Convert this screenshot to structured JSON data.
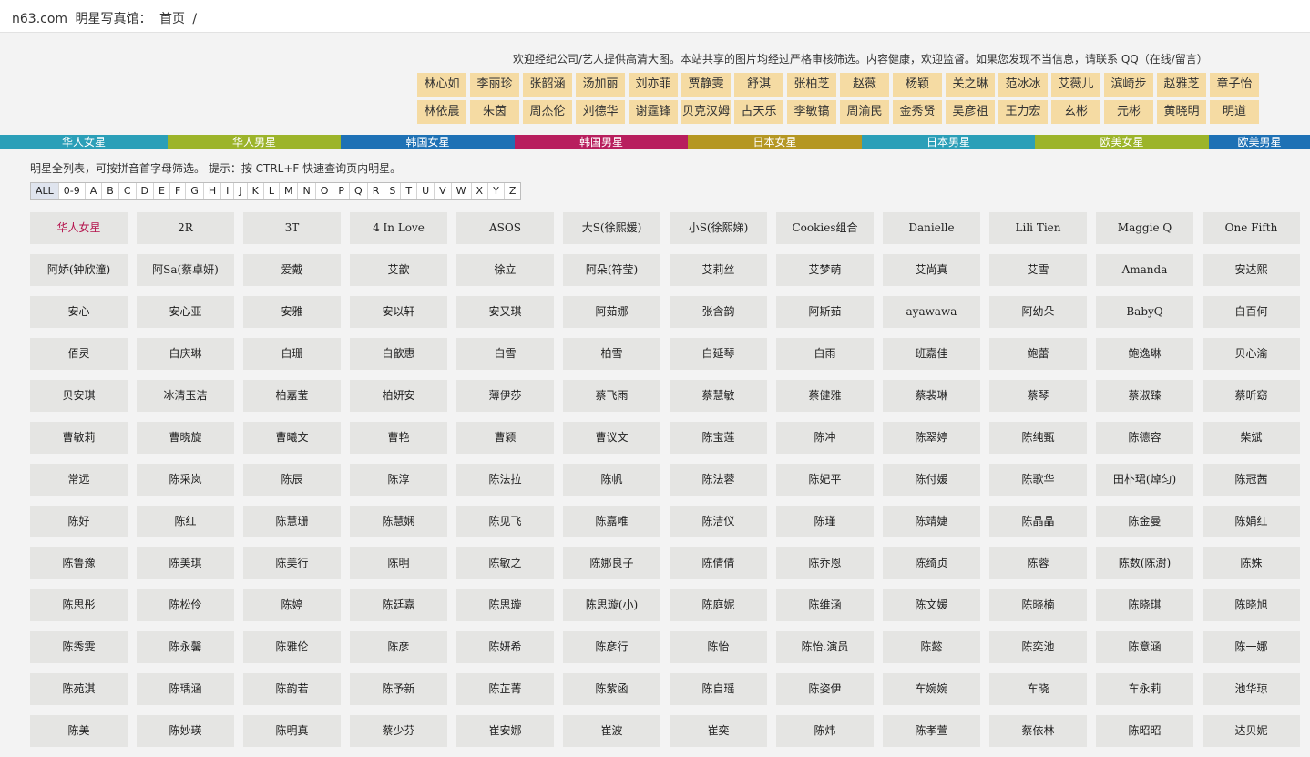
{
  "header": {
    "site": "n63.com",
    "section": "明星写真馆：",
    "crumb": "首页",
    "sep": "/"
  },
  "notice": "欢迎经纪公司/艺人提供高清大图。本站共享的图片均经过严格审核筛选。内容健康，欢迎监督。如果您发现不当信息，请联系 QQ（在线/留言）",
  "featured": [
    [
      "林心如",
      "李丽珍",
      "张韶涵",
      "汤加丽",
      "刘亦菲",
      "贾静雯",
      "舒淇",
      "张柏芝",
      "赵薇",
      "杨颖",
      "关之琳",
      "范冰冰",
      "艾薇儿",
      "滨崎步",
      "赵雅芝",
      "章子怡"
    ],
    [
      "林依晨",
      "朱茵",
      "周杰伦",
      "刘德华",
      "谢霆锋",
      "贝克汉姆",
      "古天乐",
      "李敏镐",
      "周渝民",
      "金秀贤",
      "吴彦祖",
      "王力宏",
      "玄彬",
      "元彬",
      "黄晓明",
      "明道"
    ]
  ],
  "categories": [
    {
      "label": "华人女星",
      "color": "#2b9fb8"
    },
    {
      "label": "华人男星",
      "color": "#9cb42a"
    },
    {
      "label": "韩国女星",
      "color": "#1e71b5"
    },
    {
      "label": "韩国男星",
      "color": "#b81e5e"
    },
    {
      "label": "日本女星",
      "color": "#b59722"
    },
    {
      "label": "日本男星",
      "color": "#2b9fb8"
    },
    {
      "label": "欧美女星",
      "color": "#9cb42a"
    },
    {
      "label": "欧美男星",
      "color": "#1e71b5"
    }
  ],
  "hint": "明星全列表，可按拼音首字母筛选。 提示：按 CTRL+F 快速查询页内明星。",
  "letters": [
    "ALL",
    "0-9",
    "A",
    "B",
    "C",
    "D",
    "E",
    "F",
    "G",
    "H",
    "I",
    "J",
    "K",
    "L",
    "M",
    "N",
    "O",
    "P",
    "Q",
    "R",
    "S",
    "T",
    "U",
    "V",
    "W",
    "X",
    "Y",
    "Z"
  ],
  "grid": [
    [
      "华人女星",
      "2R",
      "3T",
      "4 In Love",
      "ASOS",
      "大S(徐熙媛)",
      "小S(徐熙娣)",
      "Cookies组合",
      "Danielle",
      "Lili Tien",
      "Maggie Q",
      "One Fifth"
    ],
    [
      "阿娇(钟欣潼)",
      "阿Sa(蔡卓妍)",
      "爱戴",
      "艾歆",
      "徐立",
      "阿朵(符莹)",
      "艾莉丝",
      "艾梦萌",
      "艾尚真",
      "艾雪",
      "Amanda",
      "安达熙"
    ],
    [
      "安心",
      "安心亚",
      "安雅",
      "安以轩",
      "安又琪",
      "阿茹娜",
      "张含韵",
      "阿斯茹",
      "ayawawa",
      "阿幼朵",
      "BabyQ",
      "白百何"
    ],
    [
      "佰灵",
      "白庆琳",
      "白珊",
      "白歆惠",
      "白雪",
      "柏雪",
      "白延琴",
      "白雨",
      "班嘉佳",
      "鲍蕾",
      "鲍逸琳",
      "贝心渝"
    ],
    [
      "贝安琪",
      "冰清玉洁",
      "柏嘉莹",
      "柏妍安",
      "薄伊莎",
      "蔡飞雨",
      "蔡慧敏",
      "蔡健雅",
      "蔡裴琳",
      "蔡琴",
      "蔡淑臻",
      "蔡昕窈"
    ],
    [
      "曹敏莉",
      "曹晓旋",
      "曹曦文",
      "曹艳",
      "曹颖",
      "曹议文",
      "陈宝莲",
      "陈冲",
      "陈翠婷",
      "陈纯甄",
      "陈德容",
      "柴斌"
    ],
    [
      "常远",
      "陈采岚",
      "陈辰",
      "陈淳",
      "陈法拉",
      "陈帆",
      "陈法蓉",
      "陈妃平",
      "陈付媛",
      "陈歌华",
      "田朴珺(焯匀)",
      "陈冠茜"
    ],
    [
      "陈好",
      "陈红",
      "陈慧珊",
      "陈慧娴",
      "陈见飞",
      "陈嘉唯",
      "陈洁仪",
      "陈瑾",
      "陈靖婕",
      "陈晶晶",
      "陈金曼",
      "陈娟红"
    ],
    [
      "陈鲁豫",
      "陈美琪",
      "陈美行",
      "陈明",
      "陈敏之",
      "陈娜良子",
      "陈倩倩",
      "陈乔恩",
      "陈绮贞",
      "陈蓉",
      "陈数(陈澍)",
      "陈姝"
    ],
    [
      "陈思彤",
      "陈松伶",
      "陈婷",
      "陈廷嘉",
      "陈思璇",
      "陈思璇(小)",
      "陈庭妮",
      "陈维涵",
      "陈文媛",
      "陈晓楠",
      "陈晓琪",
      "陈晓旭"
    ],
    [
      "陈秀雯",
      "陈永馨",
      "陈雅伦",
      "陈彦",
      "陈妍希",
      "陈彦行",
      "陈怡",
      "陈怡.演员",
      "陈懿",
      "陈奕池",
      "陈意涵",
      "陈一娜"
    ],
    [
      "陈苑淇",
      "陈瑀涵",
      "陈韵若",
      "陈予新",
      "陈芷菁",
      "陈紫函",
      "陈自瑶",
      "陈姿伊",
      "车婉婉",
      "车晓",
      "车永莉",
      "池华琼"
    ],
    [
      "陈美",
      "陈妙瑛",
      "陈明真",
      "蔡少芬",
      "崔安娜",
      "崔波",
      "崔奕",
      "陈炜",
      "陈孝萱",
      "蔡依林",
      "陈昭昭",
      "达贝妮"
    ]
  ]
}
